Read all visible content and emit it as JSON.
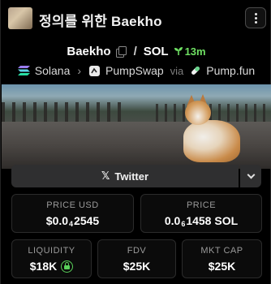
{
  "header": {
    "title": "정의를 위한 Baekho",
    "avatar_icon": "token-avatar",
    "menu_icon": "vertical-ellipsis-icon"
  },
  "pair": {
    "base": "Baekho",
    "separator": "/",
    "quote": "SOL",
    "age": "13m",
    "age_color": "#6fe063"
  },
  "route": {
    "chain": "Solana",
    "dex": "PumpSwap",
    "via_label": "via",
    "launchpad": "Pump.fun"
  },
  "socials": {
    "twitter_label": "Twitter"
  },
  "stats": {
    "price_usd": {
      "label": "PRICE USD",
      "prefix": "$0.0",
      "zeros": "4",
      "digits": "2545"
    },
    "price_native": {
      "label": "PRICE",
      "prefix": "0.0",
      "zeros": "6",
      "digits": "1458 SOL"
    },
    "liquidity": {
      "label": "LIQUIDITY",
      "value": "$18K"
    },
    "fdv": {
      "label": "FDV",
      "value": "$25K"
    },
    "mkt_cap": {
      "label": "MKT CAP",
      "value": "$25K"
    }
  },
  "colors": {
    "background": "#000000",
    "accent_green": "#5ad15a"
  }
}
